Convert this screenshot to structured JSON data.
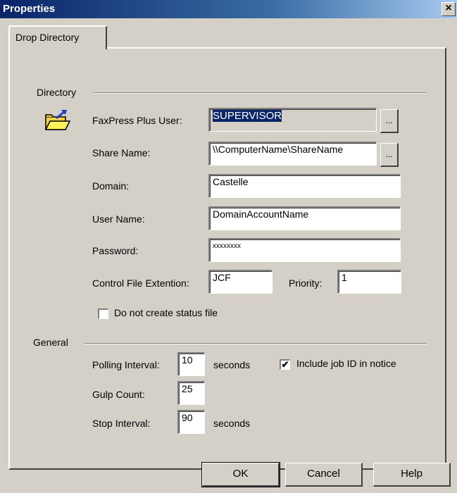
{
  "window": {
    "title": "Properties",
    "close_glyph": "×"
  },
  "tabs": [
    {
      "label": "Drop Directory",
      "active": true
    }
  ],
  "directory": {
    "group_label": "Directory",
    "icon": "open-folder-icon",
    "faxpress_user": {
      "label": "FaxPress Plus User:",
      "value": "SUPERVISOR"
    },
    "share_name": {
      "label": "Share Name:",
      "value": "\\\\ComputerName\\ShareName"
    },
    "domain": {
      "label": "Domain:",
      "value": "Castelle"
    },
    "user_name": {
      "label": "User Name:",
      "value": "DomainAccountName"
    },
    "password": {
      "label": "Password:",
      "value": "xxxxxxxx"
    },
    "control_ext": {
      "label": "Control File Extention:",
      "value": "JCF"
    },
    "priority": {
      "label": "Priority:",
      "value": "1"
    },
    "no_status_file": {
      "label": "Do not create status file",
      "checked": false
    },
    "ellipsis_label": "..."
  },
  "general": {
    "group_label": "General",
    "polling_interval": {
      "label": "Polling Interval:",
      "value": "10",
      "unit": "seconds"
    },
    "include_job_id": {
      "label": "Include job ID in notice",
      "checked": true
    },
    "gulp_count": {
      "label": "Gulp Count:",
      "value": "25"
    },
    "stop_interval": {
      "label": "Stop Interval:",
      "value": "90",
      "unit": "seconds"
    }
  },
  "buttons": {
    "ok": "OK",
    "cancel": "Cancel",
    "help": "Help"
  },
  "check_glyph": "✔"
}
